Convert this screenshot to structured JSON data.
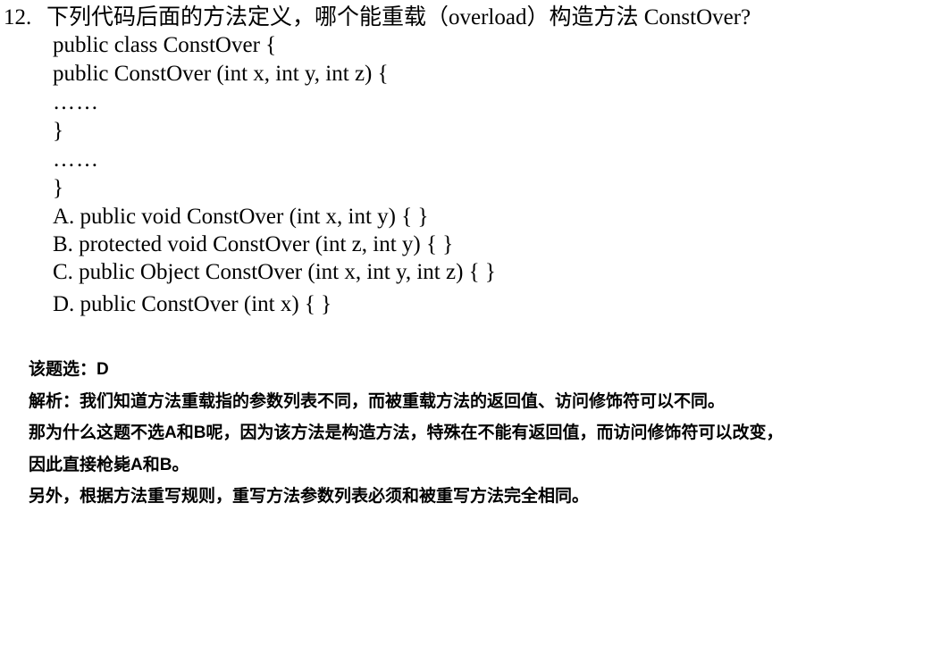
{
  "question": {
    "number": "12.",
    "text": "下列代码后面的方法定义，哪个能重载（overload）构造方法 ConstOver?",
    "code": [
      "public class ConstOver {",
      "public ConstOver (int x, int y, int z) {",
      "……",
      "}",
      "……",
      "}"
    ],
    "options": [
      "A. public void ConstOver (int x, int y) { }",
      "B. protected void ConstOver (int z, int y) { }",
      "C. public Object ConstOver (int x, int y, int z) { }",
      "D. public ConstOver (int x) { }"
    ]
  },
  "answer": {
    "choice_line": "该题选：D",
    "analysis": "解析：我们知道方法重载指的参数列表不同，而被重载方法的返回值、访问修饰符可以不同。",
    "reason": "那为什么这题不选A和B呢，因为该方法是构造方法，特殊在不能有返回值，而访问修饰符可以改变，因此直接枪毙A和B。",
    "extra": "另外，根据方法重写规则，重写方法参数列表必须和被重写方法完全相同。"
  }
}
